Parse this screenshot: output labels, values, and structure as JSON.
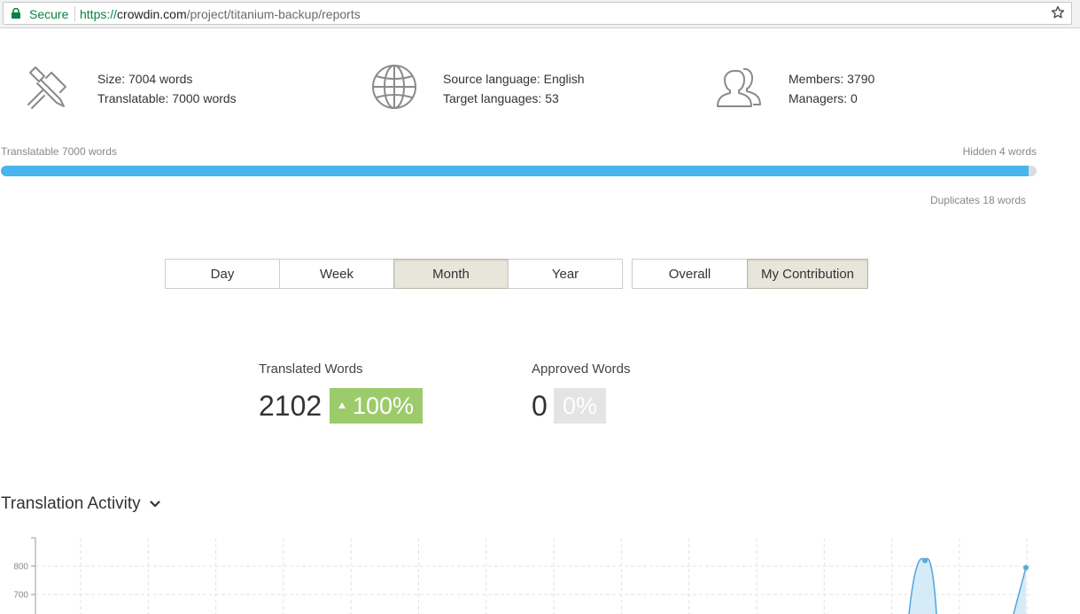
{
  "browser": {
    "secure_label": "Secure",
    "url_scheme": "https://",
    "url_host": "crowdin.com",
    "url_path": "/project/titanium-backup/reports"
  },
  "stats_header": {
    "size": "Size: 7004 words",
    "translatable": "Translatable: 7000 words",
    "source_language": "Source language: English",
    "target_languages": "Target languages: 53",
    "members": "Members: 3790",
    "managers": "Managers: 0"
  },
  "progress": {
    "left_label": "Translatable 7000 words",
    "right_label": "Hidden 4 words",
    "sub_label": "Duplicates 18 words",
    "fill_fraction": 0.992,
    "fill_color": "#47b4ec"
  },
  "period_buttons": [
    {
      "label": "Day",
      "active": false
    },
    {
      "label": "Week",
      "active": false
    },
    {
      "label": "Month",
      "active": true
    },
    {
      "label": "Year",
      "active": false
    }
  ],
  "scope_buttons": [
    {
      "label": "Overall",
      "active": false
    },
    {
      "label": "My Contribution",
      "active": true
    }
  ],
  "translated": {
    "label": "Translated Words",
    "value": "2102",
    "change": "100%"
  },
  "approved": {
    "label": "Approved Words",
    "value": "0",
    "change": "0%"
  },
  "activity": {
    "title": "Translation Activity"
  },
  "chart_data": {
    "type": "area",
    "y_ticks": [
      "800",
      "700"
    ],
    "points": [
      {
        "value": 820,
        "label": ""
      },
      {
        "value": 795,
        "label": ""
      }
    ],
    "color": "#5aa9dd"
  },
  "icons": {
    "size": "calipers-icon",
    "languages": "globe-icon",
    "members": "users-icon",
    "secure": "lock-icon",
    "bookmark": "star-icon",
    "dropdown": "chevron-down-icon",
    "trend": "triangle-up-icon"
  }
}
